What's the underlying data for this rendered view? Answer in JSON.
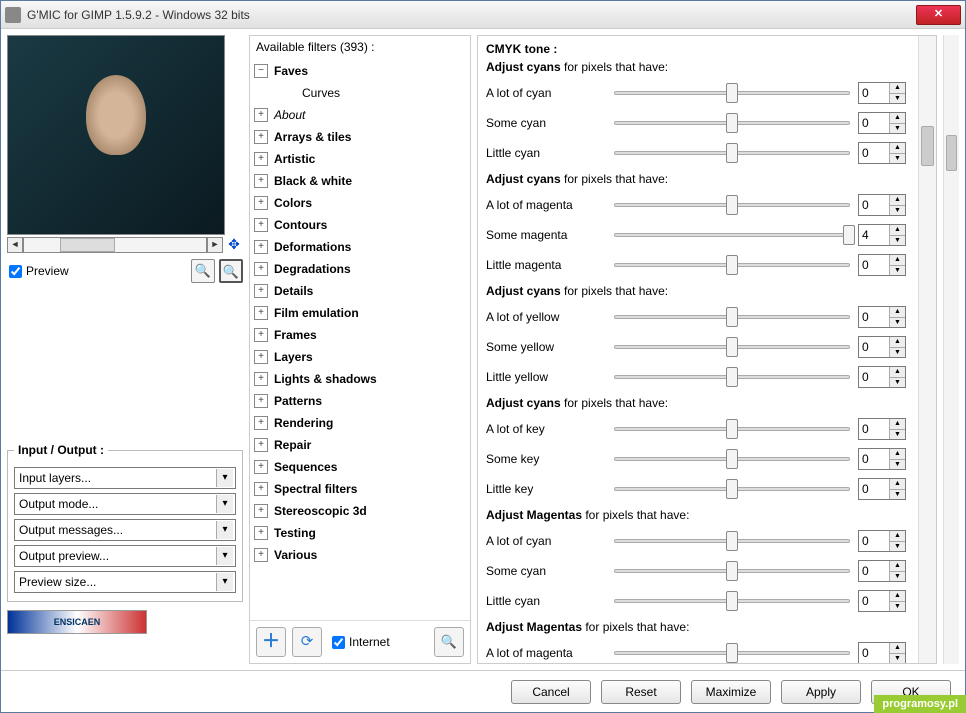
{
  "window": {
    "title": "G'MIC for GIMP 1.5.9.2 - Windows 32 bits"
  },
  "preview": {
    "checkbox_label": "Preview"
  },
  "io": {
    "legend": "Input / Output :",
    "selects": [
      "Input layers...",
      "Output mode...",
      "Output messages...",
      "Output preview...",
      "Preview size..."
    ]
  },
  "logo_text": "ENSICAEN",
  "filters": {
    "header": "Available filters (393) :",
    "items": [
      {
        "label": "Faves",
        "expand": "minus",
        "bold": true
      },
      {
        "label": "Curves",
        "expand": "none",
        "child": true
      },
      {
        "label": "About",
        "expand": "plus",
        "italic": true
      },
      {
        "label": "Arrays & tiles",
        "expand": "plus",
        "bold": true
      },
      {
        "label": "Artistic",
        "expand": "plus",
        "bold": true
      },
      {
        "label": "Black & white",
        "expand": "plus",
        "bold": true
      },
      {
        "label": "Colors",
        "expand": "plus",
        "bold": true
      },
      {
        "label": "Contours",
        "expand": "plus",
        "bold": true
      },
      {
        "label": "Deformations",
        "expand": "plus",
        "bold": true
      },
      {
        "label": "Degradations",
        "expand": "plus",
        "bold": true
      },
      {
        "label": "Details",
        "expand": "plus",
        "bold": true
      },
      {
        "label": "Film emulation",
        "expand": "plus",
        "bold": true
      },
      {
        "label": "Frames",
        "expand": "plus",
        "bold": true
      },
      {
        "label": "Layers",
        "expand": "plus",
        "bold": true
      },
      {
        "label": "Lights & shadows",
        "expand": "plus",
        "bold": true
      },
      {
        "label": "Patterns",
        "expand": "plus",
        "bold": true
      },
      {
        "label": "Rendering",
        "expand": "plus",
        "bold": true
      },
      {
        "label": "Repair",
        "expand": "plus",
        "bold": true
      },
      {
        "label": "Sequences",
        "expand": "plus",
        "bold": true
      },
      {
        "label": "Spectral filters",
        "expand": "plus",
        "bold": true
      },
      {
        "label": "Stereoscopic 3d",
        "expand": "plus",
        "bold": true
      },
      {
        "label": "Testing",
        "expand": "plus",
        "bold": true
      },
      {
        "label": "Various",
        "expand": "plus",
        "bold": true
      }
    ],
    "internet_label": "Internet"
  },
  "params": {
    "title": "CMYK tone :",
    "groups": [
      {
        "head_b": "Adjust cyans",
        "head_r": " for pixels that have:",
        "rows": [
          {
            "label": "A lot of cyan",
            "val": "0"
          },
          {
            "label": "Some cyan",
            "val": "0"
          },
          {
            "label": "Little cyan",
            "val": "0"
          }
        ]
      },
      {
        "head_b": "Adjust cyans",
        "head_r": " for pixels that have:",
        "rows": [
          {
            "label": "A lot of magenta",
            "val": "0"
          },
          {
            "label": "Some magenta",
            "val": "4",
            "thumb": "100%"
          },
          {
            "label": "Little magenta",
            "val": "0"
          }
        ]
      },
      {
        "head_b": "Adjust cyans",
        "head_r": " for pixels that have:",
        "rows": [
          {
            "label": "A lot of yellow",
            "val": "0"
          },
          {
            "label": "Some yellow",
            "val": "0"
          },
          {
            "label": "Little yellow",
            "val": "0"
          }
        ]
      },
      {
        "head_b": "Adjust cyans",
        "head_r": " for pixels that have:",
        "rows": [
          {
            "label": "A lot of key",
            "val": "0"
          },
          {
            "label": "Some key",
            "val": "0"
          },
          {
            "label": "Little key",
            "val": "0"
          }
        ]
      },
      {
        "head_b": "Adjust Magentas",
        "head_r": " for pixels that have:",
        "rows": [
          {
            "label": "A lot of cyan",
            "val": "0"
          },
          {
            "label": "Some cyan",
            "val": "0"
          },
          {
            "label": "Little cyan",
            "val": "0"
          }
        ]
      },
      {
        "head_b": "Adjust Magentas",
        "head_r": " for pixels that have:",
        "rows": [
          {
            "label": "A lot of magenta",
            "val": "0"
          }
        ]
      }
    ]
  },
  "buttons": {
    "cancel": "Cancel",
    "reset": "Reset",
    "maximize": "Maximize",
    "apply": "Apply",
    "ok": "OK"
  },
  "watermark": "programosy.pl"
}
